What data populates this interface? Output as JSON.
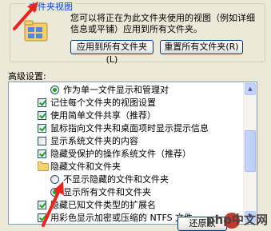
{
  "folder_views": {
    "title": "文件夹视图",
    "description": "您可以将正在为此文件夹使用的视图（例如详细信息或平铺）应用到所有文件夹。",
    "apply_button": "应用到所有文件夹(L)",
    "reset_button": "重置所有文件夹(R)"
  },
  "advanced": {
    "label": "高级设置:",
    "items": [
      {
        "kind": "radio",
        "checked": true,
        "indent": 1,
        "label": "作为单一文件显示和管理对"
      },
      {
        "kind": "checkbox",
        "checked": true,
        "indent": 0,
        "label": "记住每个文件夹的视图设置"
      },
      {
        "kind": "checkbox",
        "checked": true,
        "indent": 0,
        "label": "使用简单文件共享（推荐）"
      },
      {
        "kind": "checkbox",
        "checked": true,
        "indent": 0,
        "label": "鼠标指向文件夹和桌面项时显示提示信息"
      },
      {
        "kind": "checkbox",
        "checked": false,
        "indent": 0,
        "label": "显示系统文件夹的内容"
      },
      {
        "kind": "checkbox",
        "checked": true,
        "indent": 0,
        "label": "隐藏受保护的操作系统文件（推荐）"
      },
      {
        "kind": "folder",
        "checked": false,
        "indent": 0,
        "label": "隐藏文件和文件夹"
      },
      {
        "kind": "radio",
        "checked": false,
        "indent": 1,
        "label": "不显示隐藏的文件和文件夹"
      },
      {
        "kind": "radio",
        "checked": true,
        "indent": 1,
        "label": "显示所有文件和文件夹"
      },
      {
        "kind": "checkbox",
        "checked": true,
        "indent": 0,
        "label": "隐藏已知文件类型的扩展名"
      },
      {
        "kind": "checkbox",
        "checked": true,
        "indent": 0,
        "label": "用彩色显示加密或压缩的 NTFS 文件"
      }
    ],
    "restore_button": "还原默"
  },
  "watermark": "php中文网",
  "colors": {
    "accent": "#0046D5",
    "arrow": "#E8261B"
  }
}
